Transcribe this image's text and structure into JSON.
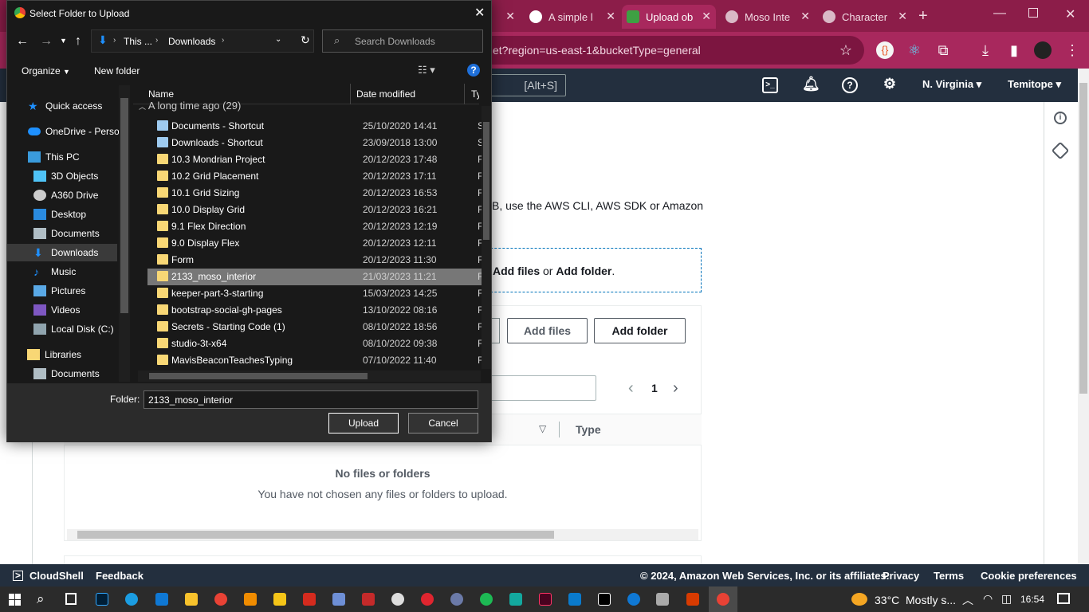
{
  "chrome": {
    "tabs": [
      {
        "label": "A simple l",
        "icon": "github-icon"
      },
      {
        "label": "Upload ob",
        "icon": "aws-upload-icon",
        "active": true
      },
      {
        "label": "Moso Inte",
        "icon": "globe-icon"
      },
      {
        "label": "Character",
        "icon": "globe-icon"
      }
    ],
    "url": "et?region=us-east-1&bucketType=general"
  },
  "aws": {
    "search_hint": "[Alt+S]",
    "region": "N. Virginia",
    "user": "Temitope",
    "description_fragment": "B, use the AWS CLI, AWS SDK or Amazon",
    "dropzone_add_files": "Add files",
    "dropzone_or": "or",
    "dropzone_add_folder": "Add folder",
    "dropzone_period": ".",
    "btn_add_files": "Add files",
    "btn_add_folder": "Add folder",
    "page_number": "1",
    "col_type": "Type",
    "empty_title": "No files or folders",
    "empty_body": "You have not chosen any files or folders to upload."
  },
  "footer": {
    "cloudshell": "CloudShell",
    "feedback": "Feedback",
    "copyright": "© 2024, Amazon Web Services, Inc. or its affiliates.",
    "privacy": "Privacy",
    "terms": "Terms",
    "cookies": "Cookie preferences"
  },
  "taskbar": {
    "weather": "33°C",
    "weather_desc": "Mostly s...",
    "time": "16:54"
  },
  "dialog": {
    "title": "Select Folder to Upload",
    "breadcrumb_1": "This ...",
    "breadcrumb_2": "Downloads",
    "search_placeholder": "Search Downloads",
    "organize": "Organize",
    "new_folder": "New folder",
    "col_name": "Name",
    "col_date": "Date modified",
    "col_type": "Ty",
    "group": "A long time ago (29)",
    "tree": [
      {
        "label": "Quick access",
        "icon": "star-icon",
        "indent": 0
      },
      {
        "label": "OneDrive - Persor",
        "icon": "cloud-icon",
        "indent": 0
      },
      {
        "label": "This PC",
        "icon": "pc-icon",
        "indent": 0
      },
      {
        "label": "3D Objects",
        "icon": "cube-icon",
        "indent": 1
      },
      {
        "label": "A360 Drive",
        "icon": "drive-icon",
        "indent": 1
      },
      {
        "label": "Desktop",
        "icon": "desktop-icon",
        "indent": 1
      },
      {
        "label": "Documents",
        "icon": "document-icon",
        "indent": 1
      },
      {
        "label": "Downloads",
        "icon": "download-icon",
        "indent": 1,
        "selected": true
      },
      {
        "label": "Music",
        "icon": "music-icon",
        "indent": 1
      },
      {
        "label": "Pictures",
        "icon": "picture-icon",
        "indent": 1
      },
      {
        "label": "Videos",
        "icon": "video-icon",
        "indent": 1
      },
      {
        "label": "Local Disk (C:)",
        "icon": "disk-icon",
        "indent": 1
      },
      {
        "label": "Libraries",
        "icon": "library-icon",
        "indent": 0
      },
      {
        "label": "Documents",
        "icon": "document-icon",
        "indent": 1
      }
    ],
    "files": [
      {
        "name": "Documents - Shortcut",
        "date": "25/10/2020 14:41",
        "type": "Sh",
        "icon": "shortcut-icon"
      },
      {
        "name": "Downloads - Shortcut",
        "date": "23/09/2018 13:00",
        "type": "Sh",
        "icon": "shortcut-icon"
      },
      {
        "name": "10.3 Mondrian Project",
        "date": "20/12/2023 17:48",
        "type": "Fi",
        "icon": "folder-icon"
      },
      {
        "name": "10.2 Grid Placement",
        "date": "20/12/2023 17:11",
        "type": "Fi",
        "icon": "folder-icon"
      },
      {
        "name": "10.1 Grid Sizing",
        "date": "20/12/2023 16:53",
        "type": "Fi",
        "icon": "folder-icon"
      },
      {
        "name": "10.0 Display Grid",
        "date": "20/12/2023 16:21",
        "type": "Fi",
        "icon": "folder-icon"
      },
      {
        "name": "9.1 Flex Direction",
        "date": "20/12/2023 12:19",
        "type": "Fi",
        "icon": "folder-icon"
      },
      {
        "name": "9.0 Display Flex",
        "date": "20/12/2023 12:11",
        "type": "Fi",
        "icon": "folder-icon"
      },
      {
        "name": "Form",
        "date": "20/12/2023 11:30",
        "type": "Fi",
        "icon": "folder-icon"
      },
      {
        "name": "2133_moso_interior",
        "date": "21/03/2023 11:21",
        "type": "Fi",
        "icon": "folder-icon",
        "selected": true
      },
      {
        "name": "keeper-part-3-starting",
        "date": "15/03/2023 14:25",
        "type": "Fi",
        "icon": "folder-icon"
      },
      {
        "name": "bootstrap-social-gh-pages",
        "date": "13/10/2022 08:16",
        "type": "Fi",
        "icon": "folder-icon"
      },
      {
        "name": "Secrets - Starting Code (1)",
        "date": "08/10/2022 18:56",
        "type": "Fi",
        "icon": "folder-icon"
      },
      {
        "name": "studio-3t-x64",
        "date": "08/10/2022 09:38",
        "type": "Fi",
        "icon": "folder-icon"
      },
      {
        "name": "MavisBeaconTeachesTyping",
        "date": "07/10/2022 11:40",
        "type": "Fi",
        "icon": "folder-icon"
      }
    ],
    "folder_label": "Folder:",
    "folder_value": "2133_moso_interior",
    "upload": "Upload",
    "cancel": "Cancel"
  }
}
